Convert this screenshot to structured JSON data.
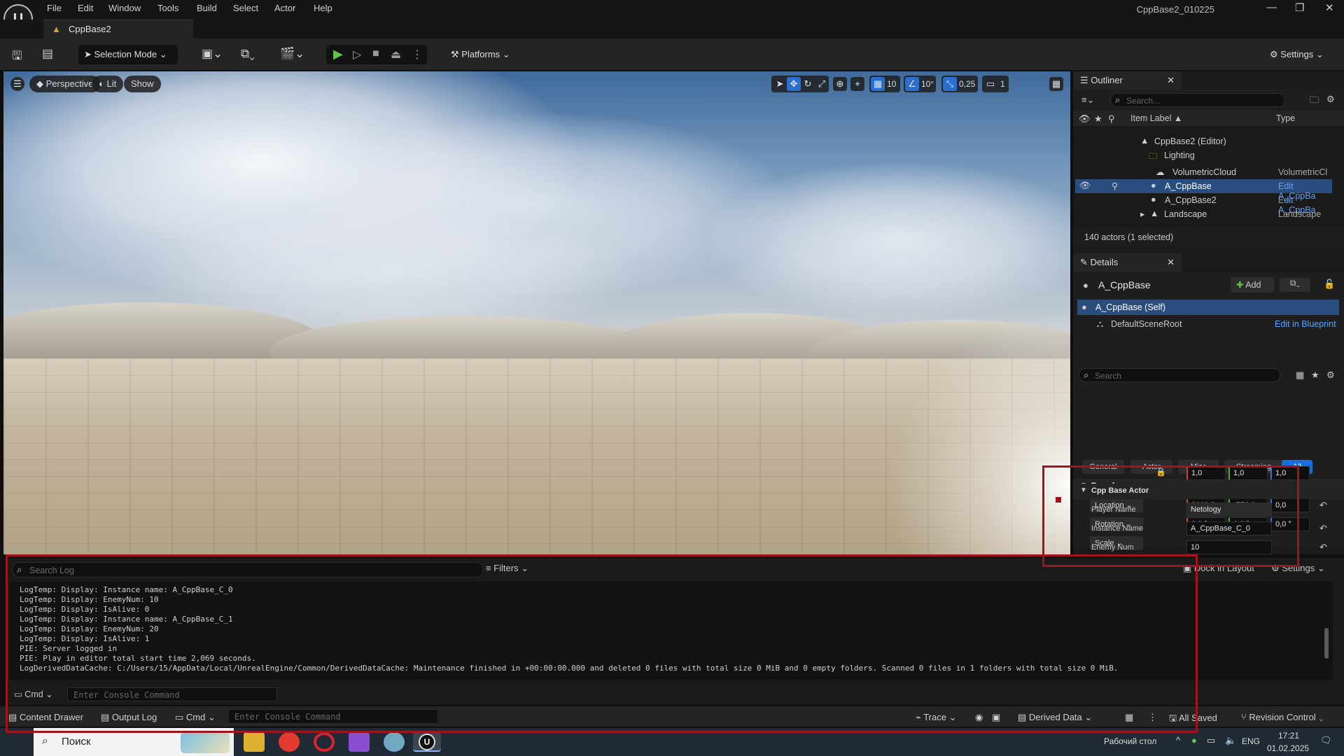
{
  "window": {
    "title": "CppBase2_010225",
    "doc_tab": "CppBase2",
    "menu": [
      "File",
      "Edit",
      "Window",
      "Tools",
      "Build",
      "Select",
      "Actor",
      "Help"
    ]
  },
  "toolbar": {
    "selection_mode": "Selection Mode",
    "platforms": "Platforms",
    "settings": "Settings"
  },
  "viewport": {
    "perspective": "Perspective",
    "lit": "Lit",
    "show": "Show",
    "grid_snap": "10",
    "angle_snap": "10°",
    "scale_snap": "0,25",
    "camera_speed": "1"
  },
  "outliner": {
    "tab": "Outliner",
    "search_placeholder": "Search...",
    "col_label": "Item Label ▲",
    "col_type": "Type",
    "rows": [
      {
        "label": "CppBase2 (Editor)",
        "type": ""
      },
      {
        "label": "Lighting",
        "type": ""
      },
      {
        "label": "VolumetricCloud",
        "type": "VolumetricCl"
      },
      {
        "label": "A_CppBase",
        "type": "Edit A_CppBa"
      },
      {
        "label": "A_CppBase2",
        "type": "Edit A_CppBa"
      },
      {
        "label": "Landscape",
        "type": "Landscape"
      }
    ],
    "status": "140 actors (1 selected)"
  },
  "details": {
    "tab": "Details",
    "actor_name": "A_CppBase",
    "add": "Add",
    "self_row": "A_CppBase (Self)",
    "root_row": "DefaultSceneRoot",
    "edit_bp": "Edit in Blueprint",
    "search_placeholder": "Search",
    "filters": [
      "General",
      "Actor",
      "Misc",
      "Streaming",
      "All"
    ],
    "transform_header": "Transform",
    "location_label": "Location",
    "rotation_label": "Rotation",
    "scale_label": "Scale",
    "location": [
      "3660,0",
      "-770,0",
      "0,0"
    ],
    "rotation": [
      "0,0 °",
      "0,0 °",
      "0,0 °"
    ],
    "scale": [
      "1,0",
      "1,0",
      "1,0"
    ],
    "cpp_header": "Cpp Base Actor",
    "player_name_label": "Player Name",
    "player_name": "Netology",
    "instance_name_label": "Instance Name",
    "instance_name": "A_CppBase_C_0",
    "enemy_num_label": "Enemy Num",
    "enemy_num": "10"
  },
  "log": {
    "search_placeholder": "Search Log",
    "filters": "Filters",
    "dock": "Dock in Layout",
    "settings": "Settings",
    "lines": [
      "LogTemp: Display: Instance name: A_CppBase_C_0",
      "LogTemp: Display: EnemyNum: 10",
      "LogTemp: Display: IsAlive: 0",
      "LogTemp: Display: Instance name: A_CppBase_C_1",
      "LogTemp: Display: EnemyNum: 20",
      "LogTemp: Display: IsAlive: 1",
      "PIE: Server logged in",
      "PIE: Play in editor total start time 2,069 seconds.",
      "LogDerivedDataCache: C:/Users/15/AppData/Local/UnrealEngine/Common/DerivedDataCache: Maintenance finished in +00:00:00.000 and deleted 0 files with total size 0 MiB and 0 empty folders. Scanned 0 files in 1 folders with total size 0 MiB."
    ],
    "cmd": "Cmd",
    "console_placeholder": "Enter Console Command"
  },
  "statusbar": {
    "content_drawer": "Content Drawer",
    "output_log": "Output Log",
    "cmd": "Cmd",
    "console_placeholder": "Enter Console Command",
    "trace": "Trace",
    "derived_data": "Derived Data",
    "all_saved": "All Saved",
    "revision_control": "Revision Control"
  },
  "taskbar": {
    "search": "Поиск",
    "desktop": "Рабочий стол",
    "lang": "ENG",
    "time": "17:21",
    "date": "01.02.2025"
  }
}
